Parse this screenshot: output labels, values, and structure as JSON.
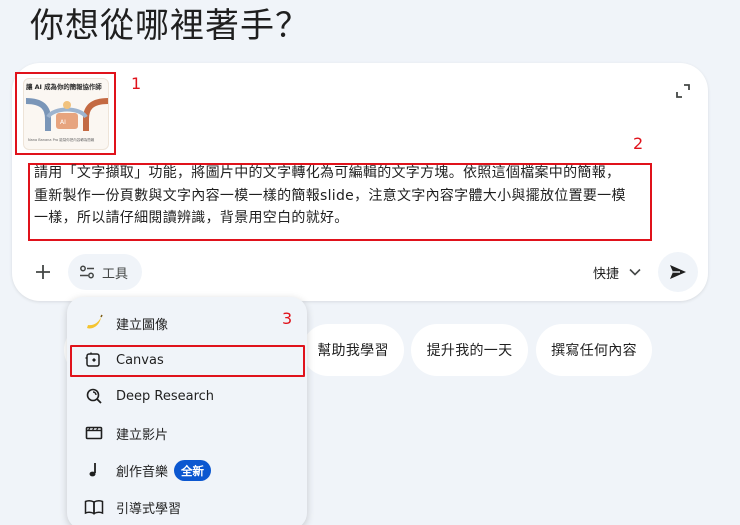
{
  "page": {
    "heading": "你想從哪裡著手？"
  },
  "composer": {
    "attachment": {
      "thumbnail_title": "讓 AI 成為你的簡報協作師",
      "thumbnail_subtitle": "Nano Banana",
      "thumbnail_caption": "Nano Banana Pro 能幫你把內容轉為簡報"
    },
    "prompt_text": "請用「文字擷取」功能，將圖片中的文字轉化為可編輯的文字方塊。依照這個檔案中的簡報，重新製作一份頁數與文字內容一模一樣的簡報slide，注意文字內容字體大小與擺放位置要一模一樣，所以請仔細閱讀辨識，背景用空白的就好。",
    "tools_label": "工具",
    "mode_label": "快捷"
  },
  "annotations": {
    "a1": "1",
    "a2": "2",
    "a3": "3"
  },
  "suggestions": [
    "幫助我學習",
    "提升我的一天",
    "撰寫任何內容"
  ],
  "tools_menu": {
    "items": [
      {
        "label": "建立圖像",
        "icon": "banana-icon"
      },
      {
        "label": "Canvas",
        "icon": "canvas-icon"
      },
      {
        "label": "Deep Research",
        "icon": "deep-research-icon"
      },
      {
        "label": "建立影片",
        "icon": "video-icon"
      },
      {
        "label": "創作音樂",
        "icon": "music-note-icon",
        "badge": "全新"
      },
      {
        "label": "引導式學習",
        "icon": "book-icon"
      }
    ]
  },
  "colors": {
    "accent": "#0b57d0",
    "annotation": "#e0121b",
    "background": "#f0f4f9"
  }
}
